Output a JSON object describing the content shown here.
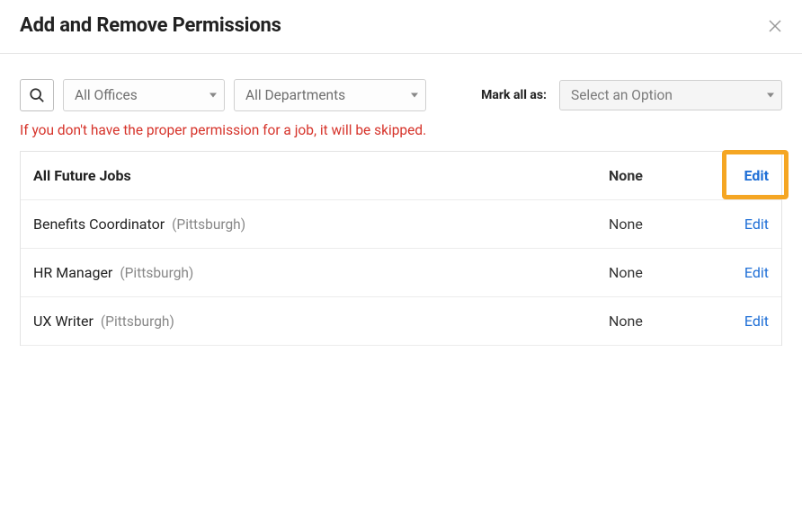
{
  "header": {
    "title": "Add and Remove Permissions"
  },
  "toolbar": {
    "offices_label": "All Offices",
    "departments_label": "All Departments",
    "mark_all_label": "Mark all as:",
    "mark_all_placeholder": "Select an Option"
  },
  "warning": "If you don't have the proper permission for a job, it will be skipped.",
  "table": {
    "rows": [
      {
        "title": "All Future Jobs",
        "location": "",
        "permission": "None",
        "action": "Edit",
        "bold": true
      },
      {
        "title": "Benefits Coordinator",
        "location": "(Pittsburgh)",
        "permission": "None",
        "action": "Edit",
        "bold": false
      },
      {
        "title": "HR Manager",
        "location": "(Pittsburgh)",
        "permission": "None",
        "action": "Edit",
        "bold": false
      },
      {
        "title": "UX Writer",
        "location": "(Pittsburgh)",
        "permission": "None",
        "action": "Edit",
        "bold": false
      }
    ]
  },
  "highlight": {
    "row_index": 0
  }
}
